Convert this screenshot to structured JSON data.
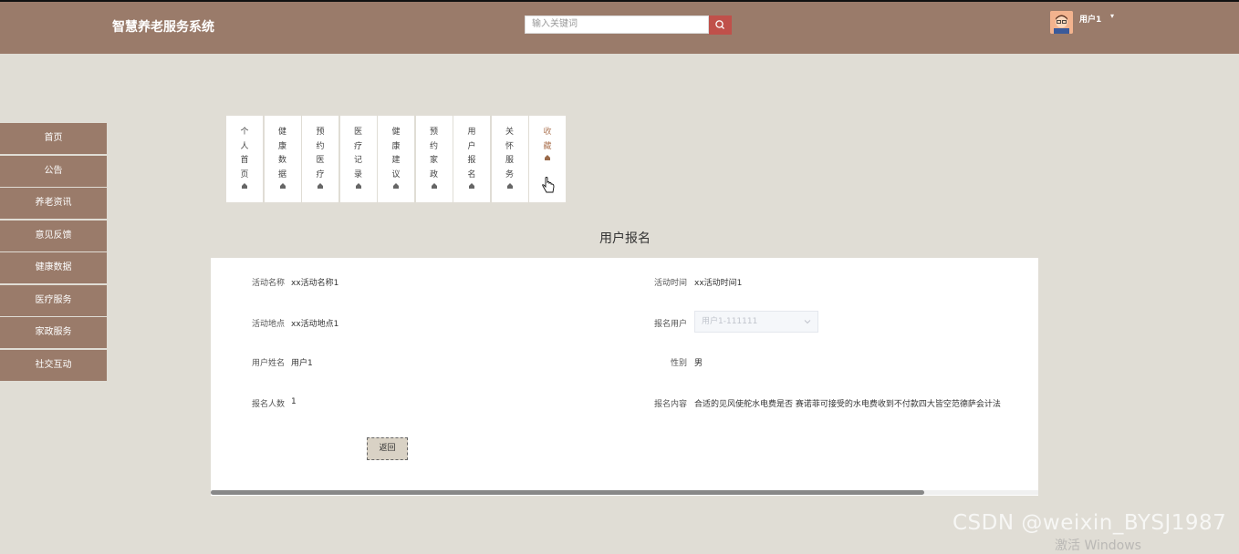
{
  "header": {
    "app_title": "智慧养老服务系统",
    "search_placeholder": "输入关键词",
    "user_name": "用户1",
    "user_caret": "▾"
  },
  "sidebar": {
    "items": [
      {
        "label": "首页"
      },
      {
        "label": "公告"
      },
      {
        "label": "养老资讯"
      },
      {
        "label": "意见反馈"
      },
      {
        "label": "健康数据"
      },
      {
        "label": "医疗服务"
      },
      {
        "label": "家政服务"
      },
      {
        "label": "社交互动"
      }
    ]
  },
  "tabs": [
    {
      "label": "个人首页"
    },
    {
      "label": "健康数据"
    },
    {
      "label": "预约医疗"
    },
    {
      "label": "医疗记录"
    },
    {
      "label": "健康建议"
    },
    {
      "label": "预约家政"
    },
    {
      "label": "用户报名"
    },
    {
      "label": "关怀服务"
    },
    {
      "label": "收藏"
    }
  ],
  "page": {
    "heading": "用户报名",
    "fields": {
      "activity_name_label": "活动名称",
      "activity_name_value": "xx活动名称1",
      "activity_time_label": "活动时间",
      "activity_time_value": "xx活动时间1",
      "activity_location_label": "活动地点",
      "activity_location_value": "xx活动地点1",
      "signup_user_label": "报名用户",
      "signup_user_value": "用户1-111111",
      "user_fullname_label": "用户姓名",
      "user_fullname_value": "用户1",
      "gender_label": "性别",
      "gender_value": "男",
      "signup_count_label": "报名人数",
      "signup_count_value": "1",
      "signup_content_label": "报名内容",
      "signup_content_value": "合适的见风使舵水电费是否 赛诺菲可接受的水电费收到不付款四大皆空范德萨会计法"
    },
    "back_label": "返回"
  },
  "overlay": {
    "watermark": "CSDN @weixin_BYSJ1987",
    "activate": "激活 Windows"
  }
}
